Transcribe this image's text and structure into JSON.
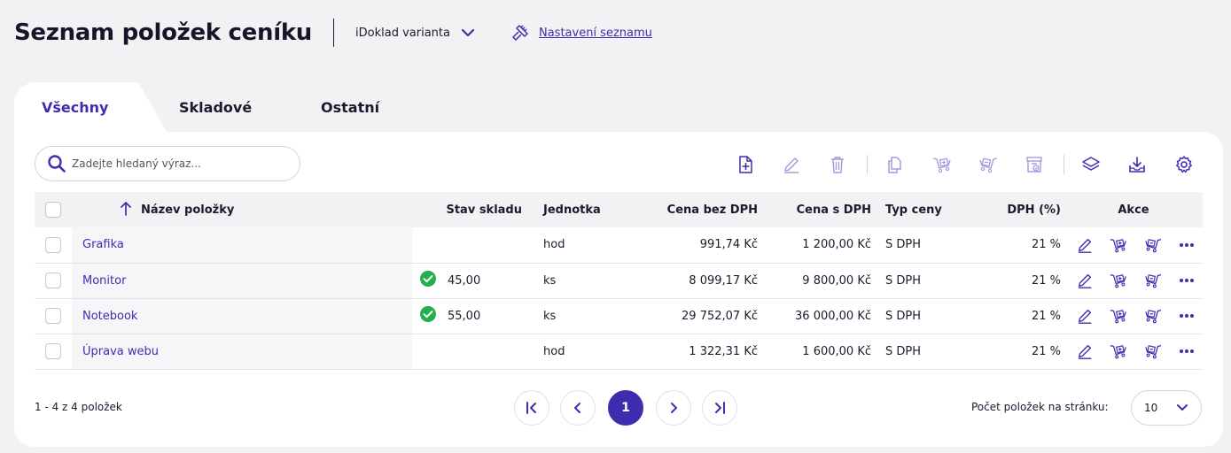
{
  "header": {
    "title": "Seznam položek ceníku",
    "variant_label": "iDoklad varianta",
    "settings_link": "Nastavení seznamu"
  },
  "tabs": [
    {
      "label": "Všechny",
      "active": true
    },
    {
      "label": "Skladové",
      "active": false
    },
    {
      "label": "Ostatní",
      "active": false
    }
  ],
  "search": {
    "placeholder": "Zadejte hledaný výraz..."
  },
  "toolbar": {
    "icons": [
      "add-document-icon",
      "edit-icon",
      "delete-icon",
      "copy-icon",
      "cart-add-icon",
      "cart-remove-icon",
      "stock-card-icon",
      "layers-icon",
      "download-icon",
      "gear-icon"
    ]
  },
  "table": {
    "columns": {
      "name": "Název položky",
      "stock": "Stav skladu",
      "unit": "Jednotka",
      "price_without_vat": "Cena bez DPH",
      "price_with_vat": "Cena s DPH",
      "price_type": "Typ ceny",
      "vat": "DPH (%)",
      "actions": "Akce"
    },
    "rows": [
      {
        "name": "Grafika",
        "stock": "",
        "stock_ok": false,
        "unit": "hod",
        "price_without_vat": "991,74 Kč",
        "price_with_vat": "1 200,00 Kč",
        "price_type": "S DPH",
        "vat": "21 %"
      },
      {
        "name": "Monitor",
        "stock": "45,00",
        "stock_ok": true,
        "unit": "ks",
        "price_without_vat": "8 099,17 Kč",
        "price_with_vat": "9 800,00 Kč",
        "price_type": "S DPH",
        "vat": "21 %"
      },
      {
        "name": "Notebook",
        "stock": "55,00",
        "stock_ok": true,
        "unit": "ks",
        "price_without_vat": "29 752,07 Kč",
        "price_with_vat": "36 000,00 Kč",
        "price_type": "S DPH",
        "vat": "21 %"
      },
      {
        "name": "Úprava webu",
        "stock": "",
        "stock_ok": false,
        "unit": "hod",
        "price_without_vat": "1 322,31 Kč",
        "price_with_vat": "1 600,00 Kč",
        "price_type": "S DPH",
        "vat": "21 %"
      }
    ]
  },
  "footer": {
    "count_text": "1 - 4 z 4 položek",
    "current_page": "1",
    "per_page_label": "Počet položek na stránku:",
    "per_page_value": "10"
  },
  "colors": {
    "accent": "#3d2eb0",
    "success": "#22b14c",
    "background": "#f2f2f5"
  }
}
